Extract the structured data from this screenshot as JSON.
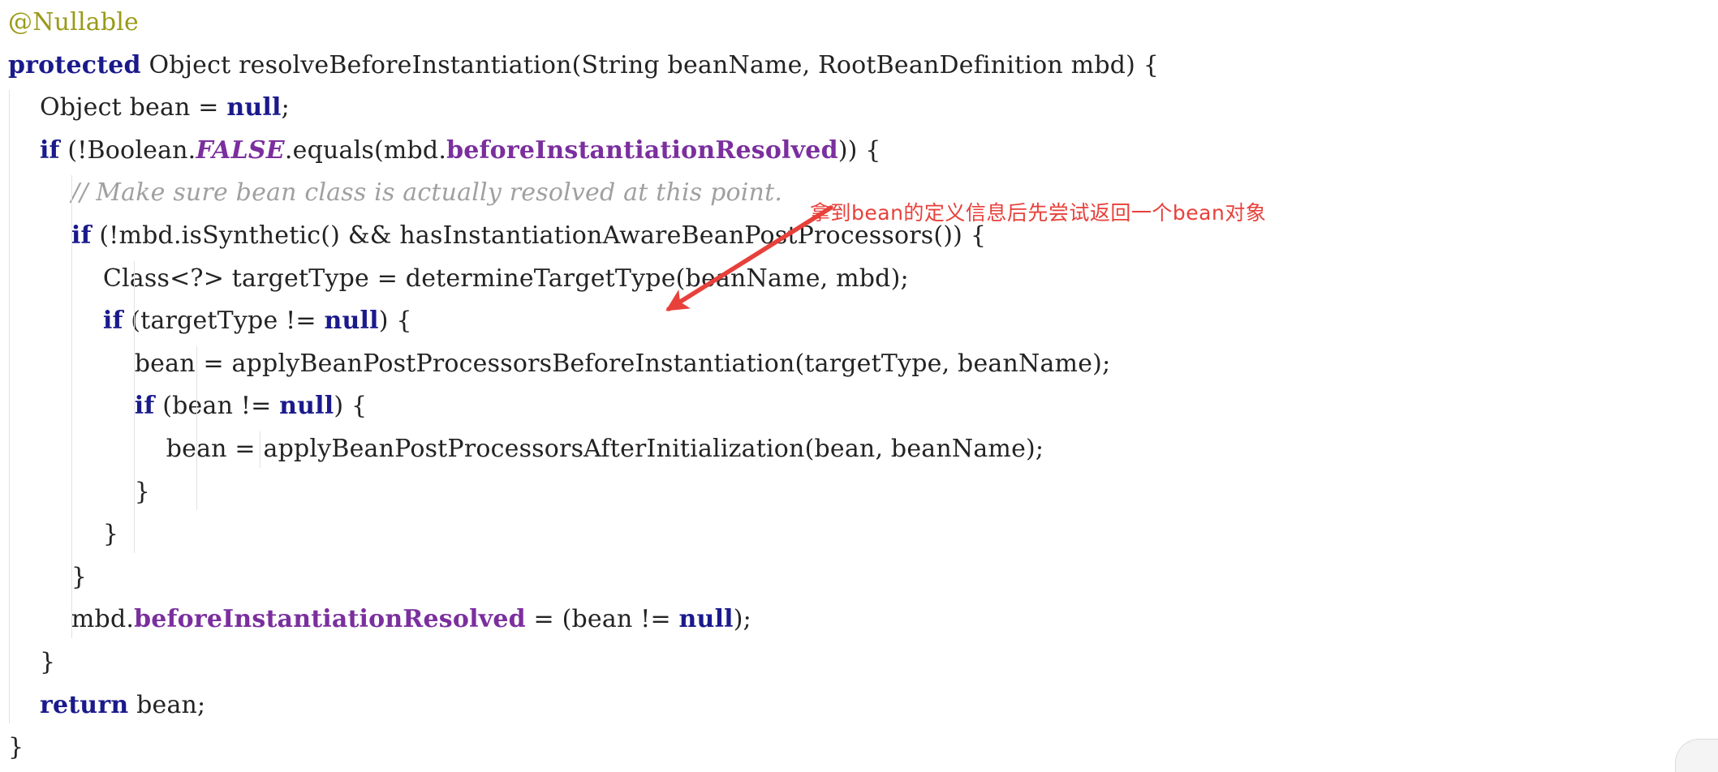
{
  "editor": {
    "title": "resolveBeforeInstantiation",
    "language": "Java",
    "background_color": "#ffffff",
    "default_text_color": "#232323",
    "colors": {
      "keyword": "#1a1a8c",
      "annotation": "#9a9a18",
      "literal": "#1a1a8c",
      "field": "#7b2f9e",
      "constant": "#7b2f9e",
      "comment": "#a0a0a0",
      "plain": "#232323",
      "marker_red": "#e8403a",
      "indent_guide": "#e2e2e6"
    }
  },
  "code": {
    "lines": [
      {
        "index": 1,
        "indent": 0,
        "tokens": [
          {
            "text": "@Nullable",
            "type": "annotation"
          }
        ]
      },
      {
        "index": 2,
        "indent": 0,
        "tokens": [
          {
            "text": "protected",
            "type": "keyword"
          },
          {
            "text": " Object resolveBeforeInstantiation(String beanName, RootBeanDefinition mbd) {",
            "type": "plain"
          }
        ]
      },
      {
        "index": 3,
        "indent": 1,
        "tokens": [
          {
            "text": "Object bean = ",
            "type": "plain"
          },
          {
            "text": "null",
            "type": "literal"
          },
          {
            "text": ";",
            "type": "plain"
          }
        ]
      },
      {
        "index": 4,
        "indent": 1,
        "tokens": [
          {
            "text": "if",
            "type": "keyword"
          },
          {
            "text": " (!Boolean.",
            "type": "plain"
          },
          {
            "text": "FALSE",
            "type": "constant"
          },
          {
            "text": ".equals(mbd.",
            "type": "plain"
          },
          {
            "text": "beforeInstantiationResolved",
            "type": "field"
          },
          {
            "text": ")) {",
            "type": "plain"
          }
        ]
      },
      {
        "index": 5,
        "indent": 2,
        "tokens": [
          {
            "text": "// Make sure bean class is actually resolved at this point.",
            "type": "comment"
          }
        ]
      },
      {
        "index": 6,
        "indent": 2,
        "tokens": [
          {
            "text": "if",
            "type": "keyword"
          },
          {
            "text": " (!mbd.isSynthetic() && hasInstantiationAwareBeanPostProcessors()) {",
            "type": "plain"
          }
        ]
      },
      {
        "index": 7,
        "indent": 3,
        "tokens": [
          {
            "text": "Class<?> targetType = determineTargetType(beanName, mbd);",
            "type": "plain"
          }
        ]
      },
      {
        "index": 8,
        "indent": 3,
        "tokens": [
          {
            "text": "if",
            "type": "keyword"
          },
          {
            "text": " (targetType != ",
            "type": "plain"
          },
          {
            "text": "null",
            "type": "literal"
          },
          {
            "text": ") {",
            "type": "plain"
          }
        ]
      },
      {
        "index": 9,
        "indent": 4,
        "tokens": [
          {
            "text": "bean = applyBeanPostProcessorsBeforeInstantiation(targetType, beanName);",
            "type": "plain"
          }
        ]
      },
      {
        "index": 10,
        "indent": 4,
        "tokens": [
          {
            "text": "if",
            "type": "keyword"
          },
          {
            "text": " (bean != ",
            "type": "plain"
          },
          {
            "text": "null",
            "type": "literal"
          },
          {
            "text": ") {",
            "type": "plain"
          }
        ]
      },
      {
        "index": 11,
        "indent": 5,
        "tokens": [
          {
            "text": "bean = applyBeanPostProcessorsAfterInitialization(bean, beanName);",
            "type": "plain"
          }
        ]
      },
      {
        "index": 12,
        "indent": 4,
        "tokens": [
          {
            "text": "}",
            "type": "plain"
          }
        ]
      },
      {
        "index": 13,
        "indent": 3,
        "tokens": [
          {
            "text": "}",
            "type": "plain"
          }
        ]
      },
      {
        "index": 14,
        "indent": 2,
        "tokens": [
          {
            "text": "}",
            "type": "plain"
          }
        ]
      },
      {
        "index": 15,
        "indent": 2,
        "tokens": [
          {
            "text": "mbd.",
            "type": "plain"
          },
          {
            "text": "beforeInstantiationResolved",
            "type": "field"
          },
          {
            "text": " = (bean != ",
            "type": "plain"
          },
          {
            "text": "null",
            "type": "literal"
          },
          {
            "text": ");",
            "type": "plain"
          }
        ]
      },
      {
        "index": 16,
        "indent": 1,
        "tokens": [
          {
            "text": "}",
            "type": "plain"
          }
        ]
      },
      {
        "index": 17,
        "indent": 1,
        "tokens": [
          {
            "text": "return",
            "type": "keyword"
          },
          {
            "text": " bean;",
            "type": "plain"
          }
        ]
      },
      {
        "index": 18,
        "indent": 0,
        "tokens": [
          {
            "text": "}",
            "type": "plain"
          }
        ]
      }
    ]
  },
  "annotation": {
    "note_text": "拿到bean的定义信息后先尝试返回一个bean对象",
    "note_color": "#e8403a",
    "arrow_color": "#e8403a",
    "arrow_label": "arrow-pointing-to-applyBeanPostProcessorsBeforeInstantiation"
  }
}
